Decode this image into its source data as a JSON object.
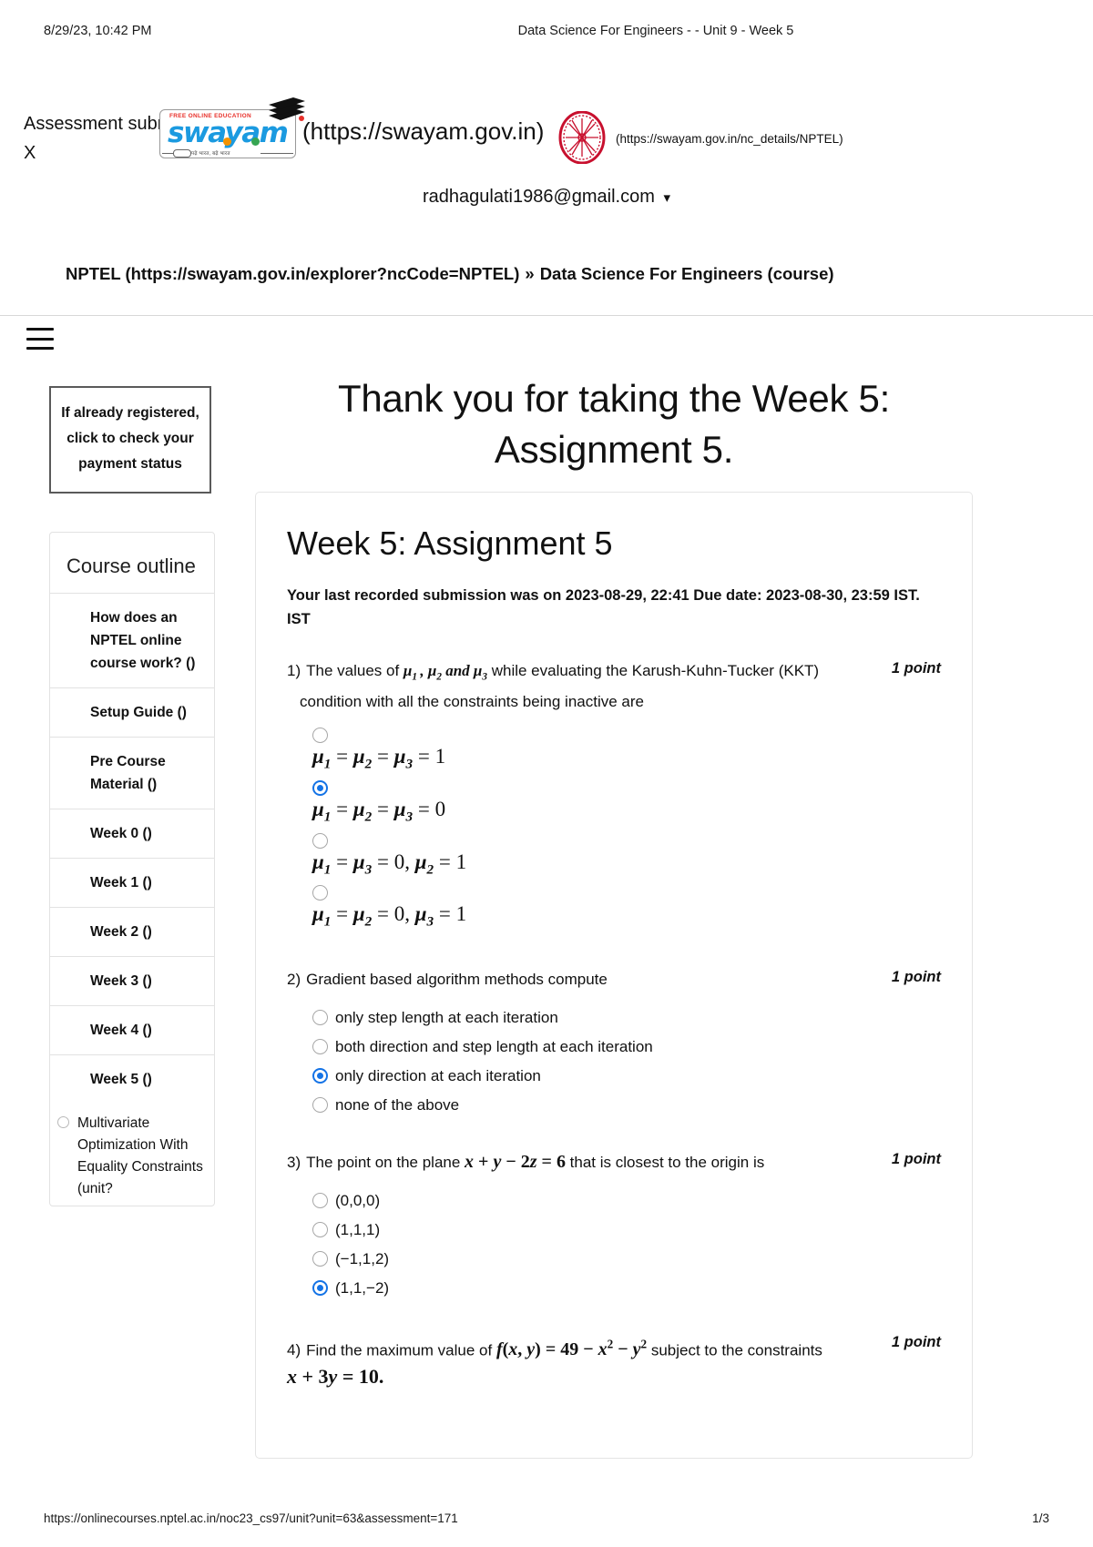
{
  "print": {
    "date": "8/29/23, 10:42 PM",
    "title": "Data Science For Engineers - - Unit 9 - Week 5",
    "footer_url": "https://onlinecourses.nptel.ac.in/noc23_cs97/unit?unit=63&assessment=171",
    "page_number": "1/3"
  },
  "banner": {
    "assessment_message": "Assessment subm",
    "close_label": "X"
  },
  "brand": {
    "swayam_wordmark": "swayam",
    "swayam_free_edu": "FREE ONLINE EDUCATION",
    "swayam_tagline": "पढ़े भारत, बढ़े भारत",
    "swayam_url": "(https://swayam.gov.in)",
    "nptel_url": "(https://swayam.gov.in/nc_details/NPTEL)"
  },
  "account": {
    "email": "radhagulati1986@gmail.com",
    "chevron": "chevron-down-icon"
  },
  "breadcrumb": {
    "first": "NPTEL (https://swayam.gov.in/explorer?ncCode=NPTEL)",
    "separator": "»",
    "second": "Data Science For Engineers (course)"
  },
  "sidebar": {
    "payment_box": "If already registered, click to check your payment status",
    "outline_title": "Course outline",
    "items": [
      {
        "label": "How does an NPTEL online course work? ()"
      },
      {
        "label": "Setup Guide ()"
      },
      {
        "label": "Pre Course Material ()"
      },
      {
        "label": "Week 0 ()"
      },
      {
        "label": "Week 1 ()"
      },
      {
        "label": "Week 2 ()"
      },
      {
        "label": "Week 3 ()"
      },
      {
        "label": "Week 4 ()"
      },
      {
        "label": "Week 5 ()"
      }
    ],
    "sub_item": "Multivariate Optimization With Equality Constraints (unit?"
  },
  "main": {
    "thank_you": "Thank you for taking the Week 5: Assignment 5.",
    "quiz_heading": "Week 5: Assignment 5",
    "submission_line": "Your last recorded submission was on 2023-08-29, 22:41  Due date: 2023-08-30, 23:59 IST. IST",
    "points_label": "1 point"
  },
  "questions": [
    {
      "number": "1)",
      "text_part1": "The values of ",
      "text_part2": " while evaluating the Karush-Kuhn-Tucker (KKT) condition with all the constraints being inactive are",
      "points": "1 point",
      "options": [
        {
          "math": "μ₁ = μ₂ = μ₃ = 1",
          "selected": false
        },
        {
          "math": "μ₁ = μ₂ = μ₃ = 0",
          "selected": true
        },
        {
          "math": "μ₁ = μ₃ = 0, μ₂ = 1",
          "selected": false
        },
        {
          "math": "μ₁ = μ₂ = 0, μ₃ = 1",
          "selected": false
        }
      ]
    },
    {
      "number": "2)",
      "text": "Gradient based algorithm methods compute",
      "points": "1 point",
      "options": [
        {
          "label": "only step length at each iteration",
          "selected": false
        },
        {
          "label": "both direction and step length at each iteration",
          "selected": false
        },
        {
          "label": "only direction at each iteration",
          "selected": true
        },
        {
          "label": "none of the above",
          "selected": false
        }
      ]
    },
    {
      "number": "3)",
      "text_before": "The point on the plane ",
      "equation": "x + y − 2z = 6",
      "text_after": " that is closest to the origin is",
      "points": "1 point",
      "options": [
        {
          "label": "(0,0,0)",
          "selected": false
        },
        {
          "label": "(1,1,1)",
          "selected": false
        },
        {
          "label": "(−1,1,2)",
          "selected": false
        },
        {
          "label": "(1,1,−2)",
          "selected": true
        }
      ]
    },
    {
      "number": "4)",
      "text_before": "Find the maximum value of ",
      "equation": "f(x, y) = 49 − x² − y²",
      "text_after": " subject to the constraints",
      "equation2": "x + 3y = 10.",
      "points": "1 point"
    }
  ]
}
